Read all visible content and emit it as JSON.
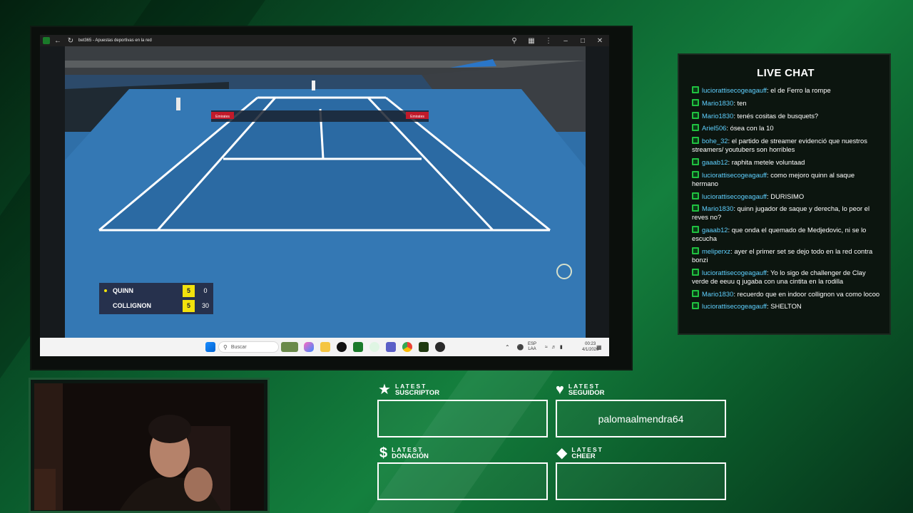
{
  "browser": {
    "tab_title": "bet365 - Apuestas deportivas en la red",
    "icons": {
      "back": "back-arrow-icon",
      "reload": "reload-icon",
      "zoom": "zoom-icon",
      "extension": "extension-icon",
      "menu": "kebab-menu-icon",
      "minimize": "minimize-icon",
      "restore": "restore-icon",
      "close": "close-icon"
    }
  },
  "scoreboard": {
    "players": [
      {
        "name": "QUINN",
        "set": "5",
        "points": "0",
        "serving": true
      },
      {
        "name": "COLLIGNON",
        "set": "5",
        "points": "30",
        "serving": false
      }
    ],
    "banner_text": "Emirates"
  },
  "taskbar": {
    "search_placeholder": "Buscar",
    "lang_line1": "ESP",
    "lang_line2": "LAA",
    "time": "00:23",
    "date": "4/1/2026"
  },
  "chat": {
    "title": "LIVE CHAT",
    "messages": [
      {
        "user": "luciorattisecogeagauff",
        "text": ": el de Ferro la rompe"
      },
      {
        "user": "Mario1830",
        "text": ": ten"
      },
      {
        "user": "Mario1830",
        "text": ": tenés cositas de busquets?"
      },
      {
        "user": "Ariel506",
        "text": ": ósea con la 10"
      },
      {
        "user": "bohe_32",
        "text": ": el partido de streamer evidenció que nuestros streamers/ youtubers son horribles"
      },
      {
        "user": "gaaab12",
        "text": ": raphita metele voluntaad"
      },
      {
        "user": "luciorattisecogeagauff",
        "text": ": como mejoro quinn al saque hermano"
      },
      {
        "user": "luciorattisecogeagauff",
        "text": ": DURISIMO"
      },
      {
        "user": "Mario1830",
        "text": ": quinn jugador de saque y derecha, lo peor el reves no?"
      },
      {
        "user": "gaaab12",
        "text": ": que onda el quemado de Medjedovic, ni se lo escucha"
      },
      {
        "user": "meliperxz",
        "text": ": ayer el primer set se dejo todo en la red contra bonzi"
      },
      {
        "user": "luciorattisecogeagauff",
        "text": ": Yo lo sigo de challenger de Clay verde de eeuu q jugaba con una cintita en la rodilla"
      },
      {
        "user": "Mario1830",
        "text": ": recuerdo que en indoor collignon va como locoo"
      },
      {
        "user": "luciorattisecogeagauff",
        "text": ": SHELTON"
      }
    ]
  },
  "alerts": {
    "latest_word": "LATEST",
    "suscriptor": {
      "kind": "SUSCRIPTOR",
      "value": "",
      "icon": "star-icon"
    },
    "seguidor": {
      "kind": "SEGUIDOR",
      "value": "palomaalmendra64",
      "icon": "heart-icon"
    },
    "donacion": {
      "kind": "DONACIÓN",
      "value": "",
      "icon": "dollar-icon"
    },
    "cheer": {
      "kind": "CHEER",
      "value": "",
      "icon": "diamond-icon"
    }
  },
  "colors": {
    "accent_green": "#20c040",
    "chat_username": "#5fd0ff",
    "court_blue": "#2f6fa8",
    "score_yellow": "#f2e20c"
  }
}
